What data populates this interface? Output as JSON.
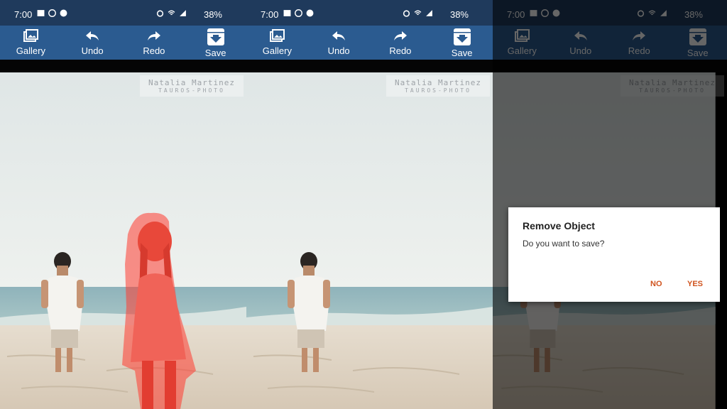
{
  "status_bar": {
    "time": "7:00",
    "battery": "38%"
  },
  "toolbar": {
    "gallery": "Gallery",
    "undo": "Undo",
    "redo": "Redo",
    "save": "Save"
  },
  "watermark": {
    "name": "Natalia Martinez",
    "subtitle": "TAUROS-PHOTO"
  },
  "dialog": {
    "title": "Remove Object",
    "message": "Do you want to save?",
    "no_label": "NO",
    "yes_label": "YES"
  },
  "colors": {
    "status_bar": "#1f3a5c",
    "toolbar": "#2b5b90",
    "mask_red": "#ff3b30",
    "dialog_accent": "#d0531e"
  },
  "icons": {
    "gallery": "gallery-icon",
    "undo": "undo-icon",
    "redo": "redo-icon",
    "save": "save-icon"
  }
}
